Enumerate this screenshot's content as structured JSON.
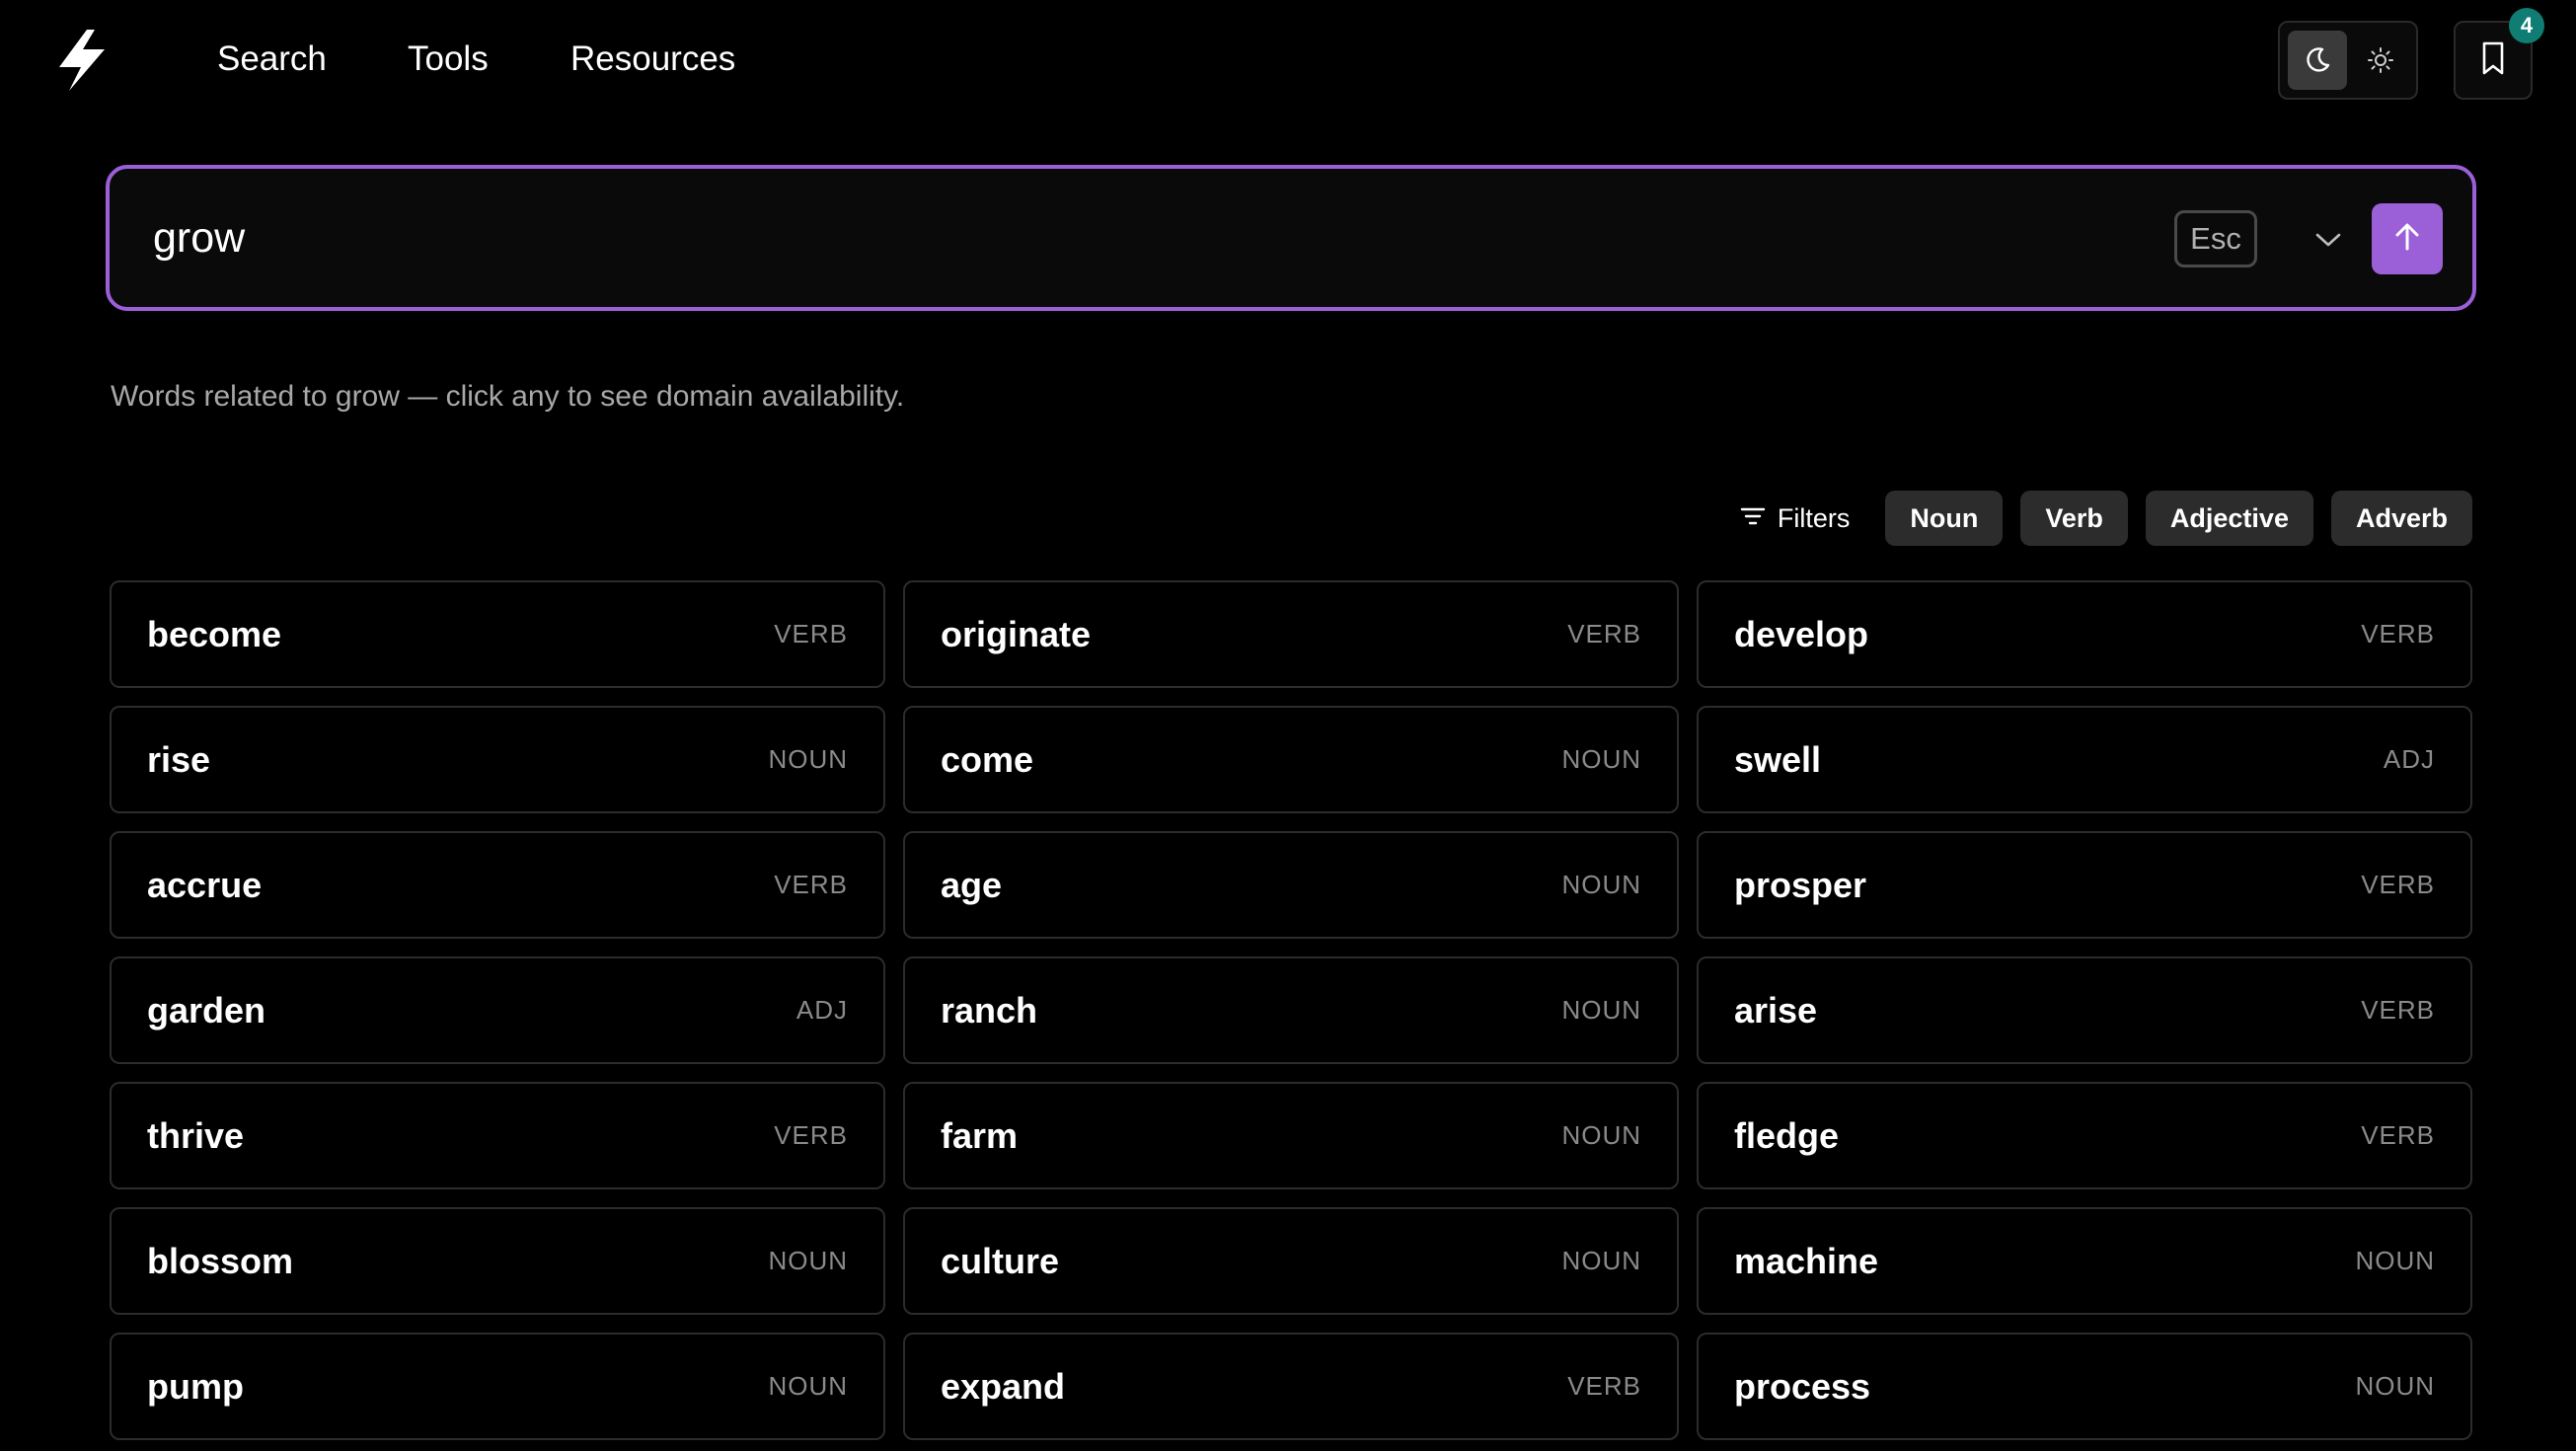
{
  "nav": {
    "links": [
      "Search",
      "Tools",
      "Resources"
    ],
    "bookmark_count": "4"
  },
  "search": {
    "query": "grow",
    "esc_label": "Esc"
  },
  "hint": "Words related to grow — click any to see domain availability.",
  "filters": {
    "label": "Filters",
    "chips": [
      "Noun",
      "Verb",
      "Adjective",
      "Adverb"
    ]
  },
  "results": [
    {
      "word": "become",
      "pos": "VERB"
    },
    {
      "word": "originate",
      "pos": "VERB"
    },
    {
      "word": "develop",
      "pos": "VERB"
    },
    {
      "word": "rise",
      "pos": "NOUN"
    },
    {
      "word": "come",
      "pos": "NOUN"
    },
    {
      "word": "swell",
      "pos": "ADJ"
    },
    {
      "word": "accrue",
      "pos": "VERB"
    },
    {
      "word": "age",
      "pos": "NOUN"
    },
    {
      "word": "prosper",
      "pos": "VERB"
    },
    {
      "word": "garden",
      "pos": "ADJ"
    },
    {
      "word": "ranch",
      "pos": "NOUN"
    },
    {
      "word": "arise",
      "pos": "VERB"
    },
    {
      "word": "thrive",
      "pos": "VERB"
    },
    {
      "word": "farm",
      "pos": "NOUN"
    },
    {
      "word": "fledge",
      "pos": "VERB"
    },
    {
      "word": "blossom",
      "pos": "NOUN"
    },
    {
      "word": "culture",
      "pos": "NOUN"
    },
    {
      "word": "machine",
      "pos": "NOUN"
    },
    {
      "word": "pump",
      "pos": "NOUN"
    },
    {
      "word": "expand",
      "pos": "VERB"
    },
    {
      "word": "process",
      "pos": "NOUN"
    }
  ],
  "colors": {
    "accent": "#9b5fd8",
    "badge": "#0f7d73",
    "background": "#000000"
  },
  "icons": {
    "logo": "lightning-bolt-icon",
    "dark_mode": "moon-icon",
    "light_mode": "sun-icon",
    "bookmark": "bookmark-icon",
    "dropdown": "chevron-down-icon",
    "submit": "arrow-up-icon",
    "filters": "filter-icon"
  }
}
